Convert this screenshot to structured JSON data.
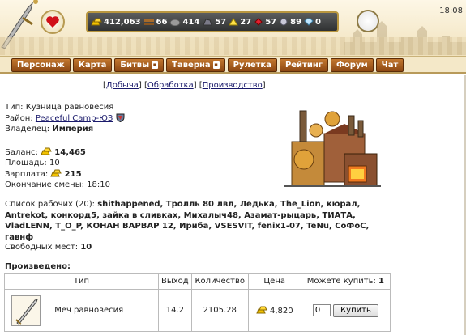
{
  "header": {
    "clock": "18:08",
    "resources": [
      {
        "icon": "gold-bars-icon",
        "value": "412,063"
      },
      {
        "icon": "wood-icon",
        "value": "66"
      },
      {
        "icon": "stone-icon",
        "value": "414"
      },
      {
        "icon": "iron-ore-icon",
        "value": "57"
      },
      {
        "icon": "sulfur-icon",
        "value": "27"
      },
      {
        "icon": "crystal-red-icon",
        "value": "57"
      },
      {
        "icon": "mercury-icon",
        "value": "89"
      },
      {
        "icon": "diamond-icon",
        "value": "0"
      }
    ]
  },
  "nav": {
    "items": [
      "Персонаж",
      "Карта",
      "Битвы",
      "Таверна",
      "Рулетка",
      "Рейтинг",
      "Форум",
      "Чат"
    ]
  },
  "tabs": {
    "extraction": "Добыча",
    "processing": "Обработка",
    "production": "Производство"
  },
  "info": {
    "type_label": "Тип:",
    "type_value": "Кузница равновесия",
    "district_label": "Район:",
    "district_value": "Peaceful Camp-ЮЗ",
    "owner_label": "Владелец:",
    "owner_value": "Империя",
    "balance_label": "Баланс:",
    "balance_value": "14,465",
    "area_label": "Площадь:",
    "area_value": "10",
    "salary_label": "Зарплата:",
    "salary_value": "215",
    "shift_end_label": "Окончание смены:",
    "shift_end_value": "18:10",
    "workers_label": "Список рабочих (20):",
    "workers_value": "shithappened, Тролль 80 лвл, Ледька, The_Lion, кюрал, Antrekot, конкорд5, зайка в сливках, Михалыч48, Азамат-рыцарь, ТИАТА, VladLENN, T_O_P, КОНАН ВАРВАР 12, Ириба, VSESVIT, fenix1-07, TeNu, СоФоС, гавнф",
    "free_label": "Свободных мест:",
    "free_value": "10"
  },
  "produced": {
    "title": "Произведено:",
    "headers": {
      "type": "Тип",
      "output": "Выход",
      "quantity": "Количество",
      "price": "Цена",
      "can_buy": "Можете купить:",
      "can_buy_count": "1"
    },
    "rows": [
      {
        "name": "Меч равновесия",
        "output": "14.2",
        "quantity": "2105.28",
        "price": "4,820",
        "input_value": "0",
        "buy_label": "Купить"
      }
    ]
  }
}
